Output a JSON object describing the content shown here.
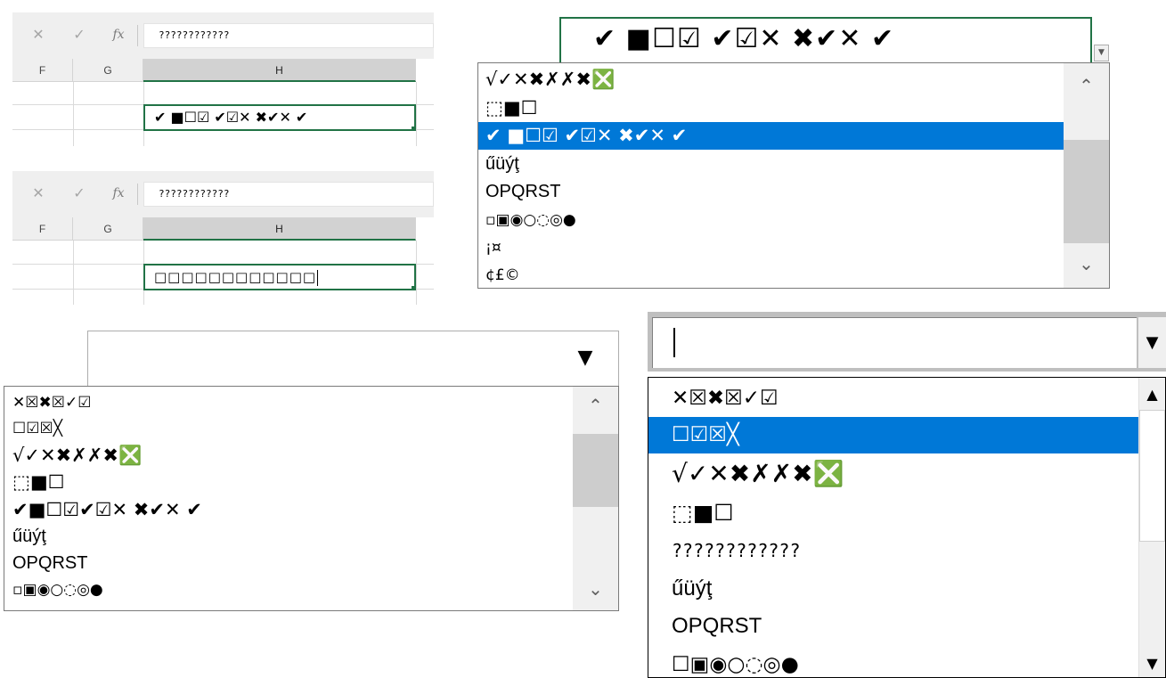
{
  "excel_top": {
    "formula_buttons": {
      "cancel": "✕",
      "enter": "✓",
      "fx": "fx"
    },
    "formula_value": "????????????",
    "columns": [
      "F",
      "G",
      "H"
    ],
    "cell_value": "✔ ■☐☑ ✔☑✕ ✖✔✕ ✔"
  },
  "excel_bottom": {
    "formula_buttons": {
      "cancel": "✕",
      "enter": "✓",
      "fx": "fx"
    },
    "formula_value": "????????????",
    "columns": [
      "F",
      "G",
      "H"
    ],
    "cell_value": "□□□□□□□□□□□□"
  },
  "combo_tr": {
    "field_value": "✔ ■☐☑ ✔☑✕ ✖✔✕ ✔",
    "items": [
      "√✓✕✖✗✗✖❎",
      "⬚■☐",
      "✔ ■☐☑ ✔☑✕ ✖✔✕ ✔",
      "űüýţ",
      "OPQRST",
      "▫▣◉○◌◎●",
      "¡¤",
      "¢£©"
    ],
    "selected_index": 2
  },
  "list_bl": {
    "field_value": "",
    "items": [
      "✕☒✖☒✓☑",
      "☐☑☒╳",
      "√✓✕✖✗✗✖❎",
      "⬚■☐",
      "✔■☐☑✔☑✕ ✖✔✕ ✔",
      "űüýţ",
      "OPQRST",
      "▫▣◉○◌◎●"
    ]
  },
  "list_br": {
    "field_value": "",
    "items": [
      "✕☒✖☒✓☑",
      "☐☑☒╳",
      "√✓✕✖✗✗✖❎",
      "⬚■☐",
      "????????????",
      "űüýţ",
      "OPQRST",
      "☐▣◉○◌◎●"
    ],
    "selected_index": 1
  },
  "colors": {
    "excel_green": "#217346",
    "selection_blue": "#0078d7",
    "scroll_track": "#f0f0f0"
  }
}
